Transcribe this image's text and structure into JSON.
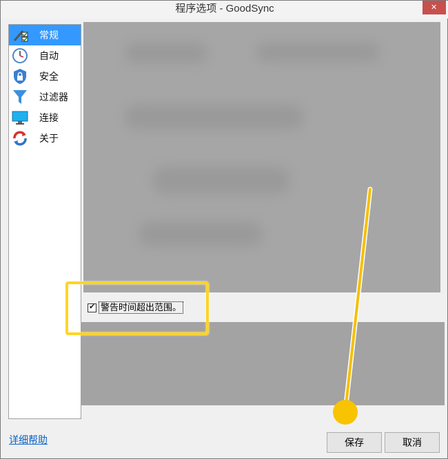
{
  "window": {
    "title": "程序选项 - GoodSync"
  },
  "sidebar": {
    "items": [
      {
        "label": "常规",
        "icon": "general-settings-icon",
        "active": true
      },
      {
        "label": "自动",
        "icon": "clock-icon",
        "active": false
      },
      {
        "label": "安全",
        "icon": "shield-lock-icon",
        "active": false
      },
      {
        "label": "过滤器",
        "icon": "funnel-icon",
        "active": false
      },
      {
        "label": "连接",
        "icon": "monitor-icon",
        "active": false
      },
      {
        "label": "关于",
        "icon": "sync-arrows-icon",
        "active": false
      }
    ]
  },
  "options": {
    "warn_time_out_of_range": {
      "label": "警告时间超出范围。",
      "checked": true
    }
  },
  "footer": {
    "help_link": "详细帮助",
    "save_label": "保存",
    "cancel_label": "取消"
  },
  "colors": {
    "accent": "#3399ff",
    "highlight": "#ffd426",
    "close": "#c7504d",
    "link": "#0b62c4"
  }
}
